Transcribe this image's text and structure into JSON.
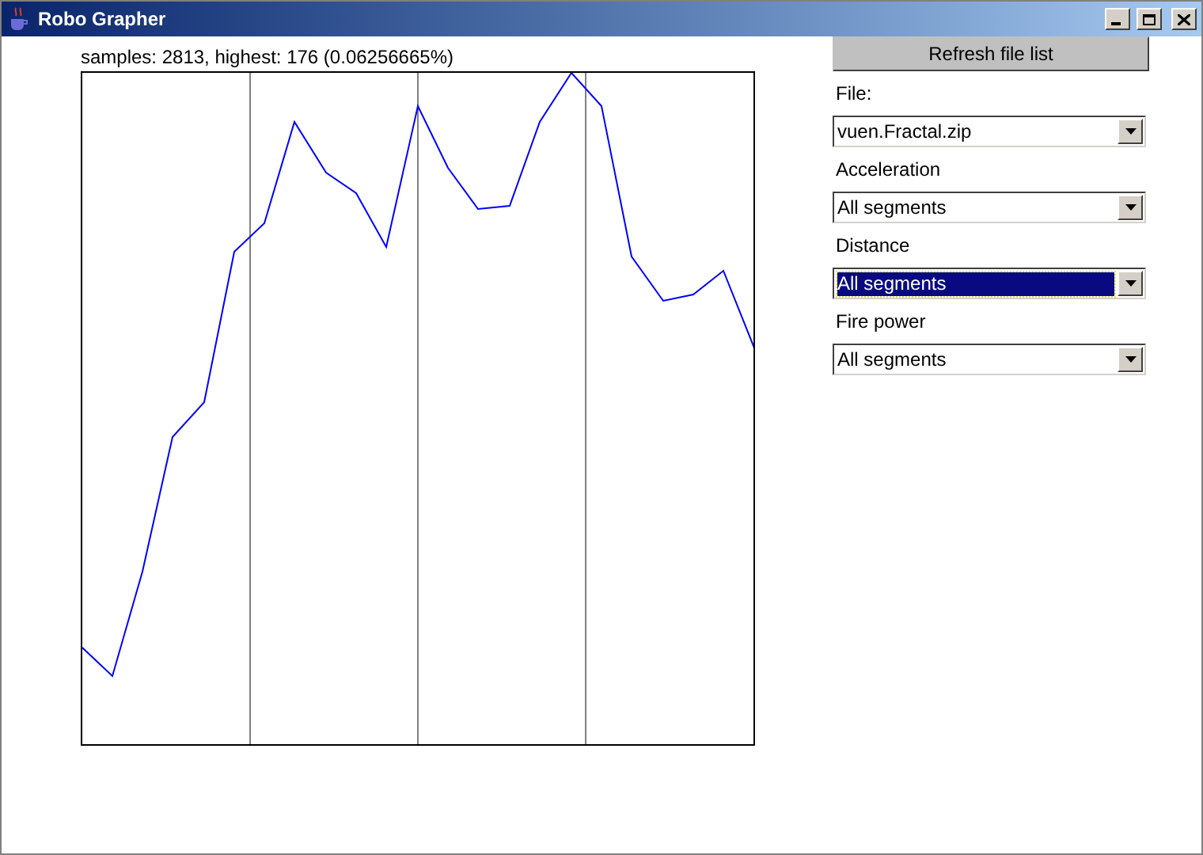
{
  "window": {
    "title": "Robo Grapher"
  },
  "graph": {
    "caption": "samples: 2813, highest: 176 (0.06256665%)"
  },
  "refresh_button": "Refresh file list",
  "selectors": [
    {
      "label": "File:",
      "value": "vuen.Fractal.zip",
      "focused": false
    },
    {
      "label": "Acceleration",
      "value": "All segments",
      "focused": false
    },
    {
      "label": "Distance",
      "value": "All segments",
      "focused": true
    },
    {
      "label": "Fire power",
      "value": "All segments",
      "focused": false
    }
  ]
}
